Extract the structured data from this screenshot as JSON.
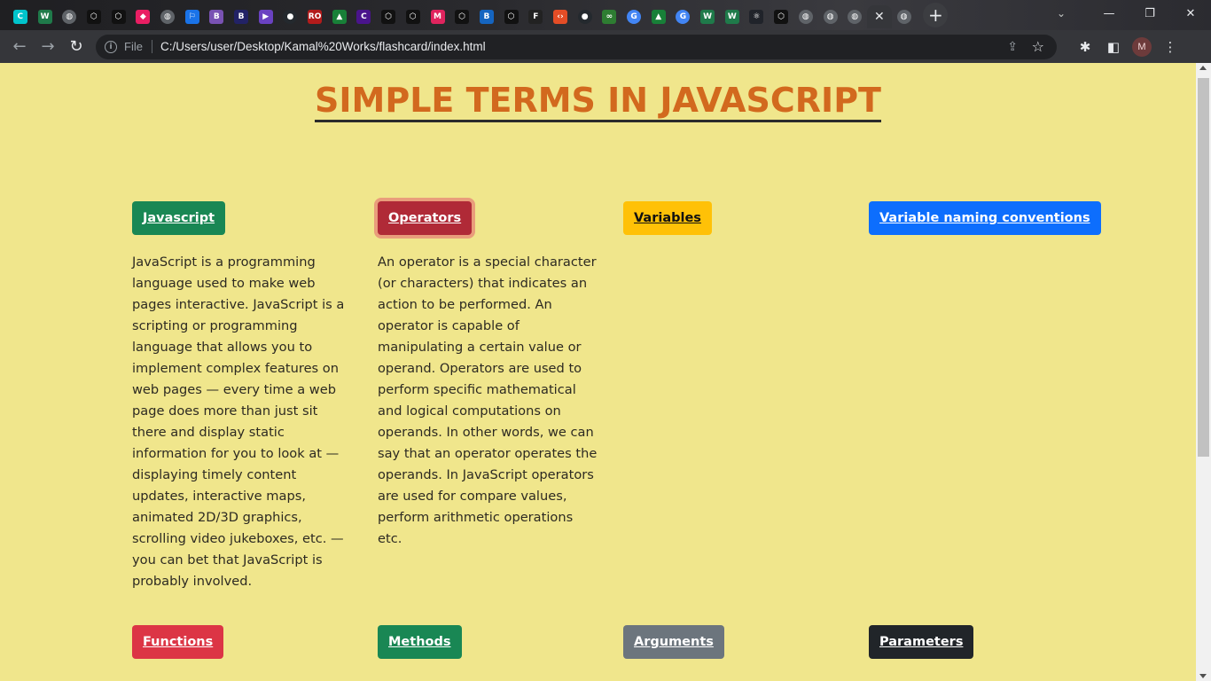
{
  "browser": {
    "tabs": [
      {
        "icon": "canva-icon",
        "glyph": "C",
        "color": "#00c4cc"
      },
      {
        "icon": "webflow-w-icon",
        "glyph": "W",
        "color": "#1f7a4a"
      },
      {
        "icon": "globe-icon",
        "glyph": "◍",
        "color": "#5f6368"
      },
      {
        "icon": "codepen-icon",
        "glyph": "⬡",
        "color": "#111111"
      },
      {
        "icon": "codepen-icon",
        "glyph": "⬡",
        "color": "#111111"
      },
      {
        "icon": "cube-icon",
        "glyph": "◆",
        "color": "#e91e63"
      },
      {
        "icon": "globe-icon",
        "glyph": "◍",
        "color": "#5f6368"
      },
      {
        "icon": "flag-icon",
        "glyph": "⚐",
        "color": "#1a73e8"
      },
      {
        "icon": "bootstrap-icon",
        "glyph": "B",
        "color": "#7952b3"
      },
      {
        "icon": "b-icon",
        "glyph": "B",
        "color": "#222266"
      },
      {
        "icon": "shapes-icon",
        "glyph": "▶",
        "color": "#6a42c1"
      },
      {
        "icon": "github-icon",
        "glyph": "●",
        "color": "#24292e"
      },
      {
        "icon": "ro-icon",
        "glyph": "RO",
        "color": "#b31b1b"
      },
      {
        "icon": "google-drive-icon",
        "glyph": "▲",
        "color": "#188038"
      },
      {
        "icon": "oc-icon",
        "glyph": "C",
        "color": "#4a148c"
      },
      {
        "icon": "codepen-icon",
        "glyph": "⬡",
        "color": "#111111"
      },
      {
        "icon": "codepen-icon",
        "glyph": "⬡",
        "color": "#111111"
      },
      {
        "icon": "maker-icon",
        "glyph": "M",
        "color": "#e0245e"
      },
      {
        "icon": "codepen-icon",
        "glyph": "⬡",
        "color": "#111111"
      },
      {
        "icon": "bootstrap-alt-icon",
        "glyph": "B",
        "color": "#1565c0"
      },
      {
        "icon": "codepen-icon",
        "glyph": "⬡",
        "color": "#111111"
      },
      {
        "icon": "frame-icon",
        "glyph": "F",
        "color": "#222222"
      },
      {
        "icon": "code-icon",
        "glyph": "‹›",
        "color": "#e44d26"
      },
      {
        "icon": "github-icon",
        "glyph": "●",
        "color": "#24292e"
      },
      {
        "icon": "infinity-icon",
        "glyph": "∞",
        "color": "#2e7d32"
      },
      {
        "icon": "google-icon",
        "glyph": "G",
        "color": "#4285f4"
      },
      {
        "icon": "google-drive-icon",
        "glyph": "▲",
        "color": "#188038"
      },
      {
        "icon": "google-icon",
        "glyph": "G",
        "color": "#4285f4"
      },
      {
        "icon": "webflow-w-icon",
        "glyph": "W",
        "color": "#1f7a4a"
      },
      {
        "icon": "webflow-w-icon",
        "glyph": "W",
        "color": "#1f7a4a"
      },
      {
        "icon": "react-icon",
        "glyph": "⚛",
        "color": "#20232a"
      },
      {
        "icon": "codepen-icon",
        "glyph": "⬡",
        "color": "#111111"
      },
      {
        "icon": "globe-icon",
        "glyph": "◍",
        "color": "#5f6368"
      },
      {
        "icon": "globe-icon",
        "glyph": "◍",
        "color": "#5f6368"
      },
      {
        "icon": "globe-icon",
        "glyph": "◍",
        "color": "#5f6368"
      },
      {
        "icon": "close-icon",
        "glyph": "✕",
        "color": "transparent",
        "active": true
      },
      {
        "icon": "globe-icon",
        "glyph": "◍",
        "color": "#5f6368"
      }
    ],
    "new_tab": "+",
    "address": {
      "scheme_label": "File",
      "url": "C:/Users/user/Desktop/Kamal%20Works/flashcard/index.html"
    },
    "profile_initial": "M"
  },
  "page": {
    "title": "SIMPLE TERMS IN JAVASCRIPT",
    "cards": [
      {
        "label": "Javascript",
        "style": "green",
        "description": "JavaScript is a programming language used to make web pages interactive. JavaScript is a scripting or programming language that allows you to implement complex features on web pages — every time a web page does more than just sit there and display static information for you to look at — displaying timely content updates, interactive maps, animated 2D/3D graphics, scrolling video jukeboxes, etc. — you can bet that JavaScript is probably involved."
      },
      {
        "label": "Operators",
        "style": "red",
        "description": "An operator is a special character (or characters) that indicates an action to be performed. An operator is capable of manipulating a certain value or operand. Operators are used to perform specific mathematical and logical computations on operands. In other words, we can say that an operator operates the operands. In JavaScript operators are used for compare values, perform arithmetic operations etc."
      },
      {
        "label": "Variables",
        "style": "yellow",
        "description": ""
      },
      {
        "label": "Variable naming conventions",
        "style": "blue",
        "description": ""
      },
      {
        "label": "Functions",
        "style": "danger",
        "description": ""
      },
      {
        "label": "Methods",
        "style": "green",
        "description": ""
      },
      {
        "label": "Arguments",
        "style": "grey",
        "description": ""
      },
      {
        "label": "Parameters",
        "style": "dark",
        "description": ""
      }
    ]
  }
}
